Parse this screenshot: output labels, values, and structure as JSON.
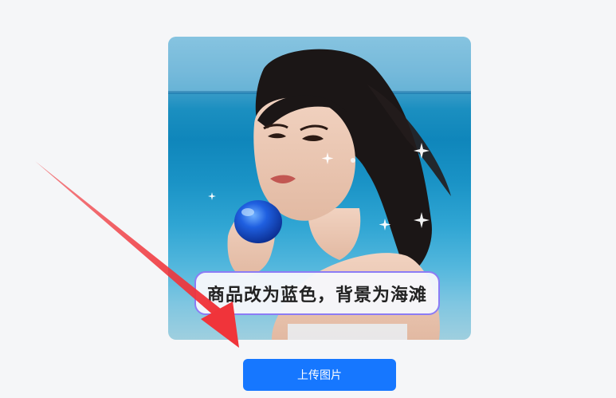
{
  "prompt_bubble": {
    "text": "商品改为蓝色，背景为海滩"
  },
  "upload": {
    "label": "上传图片"
  },
  "colors": {
    "button": "#1677ff",
    "arrow": "#f0343a",
    "bubble_border": "#8c7cf5",
    "page_background": "#f5f6f8"
  }
}
